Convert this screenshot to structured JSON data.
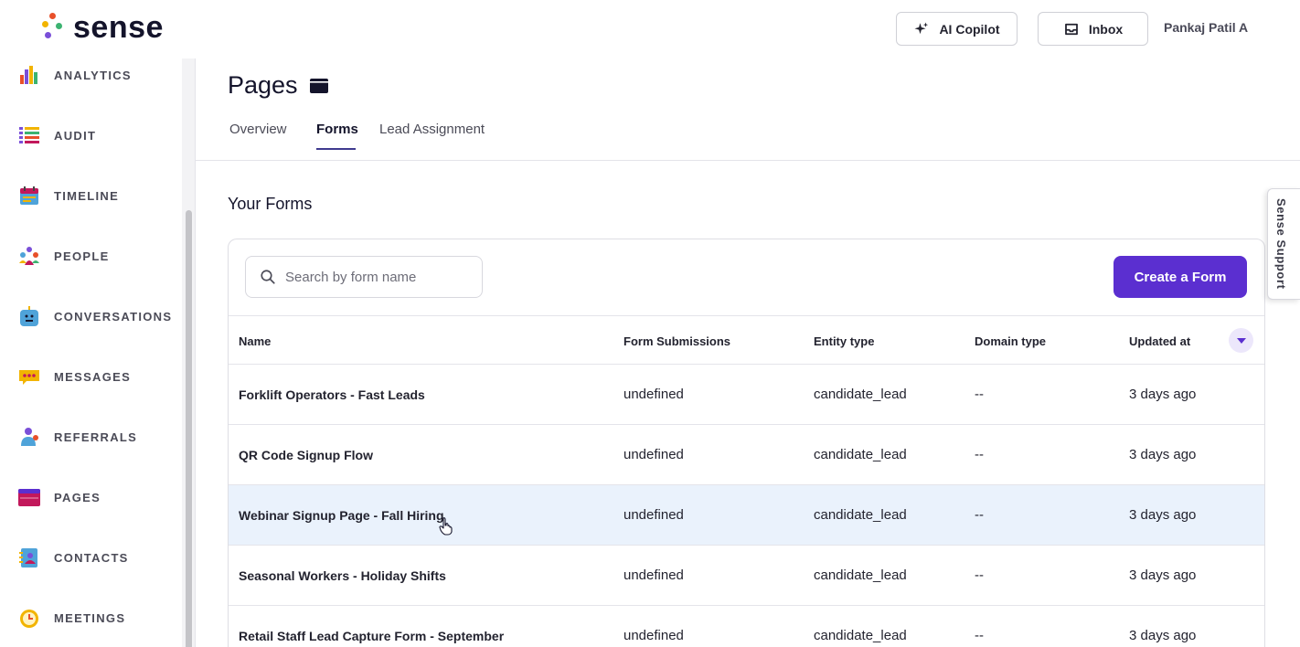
{
  "app": {
    "brand": "sense",
    "colors": {
      "accent": "#5b2fd0",
      "hover_row": "#eaf2fc",
      "logo_dots": [
        "#e8502a",
        "#f2b400",
        "#3cb371",
        "#7a4fd8"
      ]
    }
  },
  "header": {
    "copilot_label": "AI Copilot",
    "copilot_icon": "sparkle-icon",
    "inbox_label": "Inbox",
    "inbox_icon": "inbox-tray-icon",
    "user_name": "Pankaj Patil A"
  },
  "sidebar": {
    "items": [
      {
        "label": "ANALYTICS",
        "icon": "bar-chart-icon"
      },
      {
        "label": "AUDIT",
        "icon": "list-icon"
      },
      {
        "label": "TIMELINE",
        "icon": "calendar-icon"
      },
      {
        "label": "PEOPLE",
        "icon": "people-icon"
      },
      {
        "label": "CONVERSATIONS",
        "icon": "chat-bot-icon"
      },
      {
        "label": "MESSAGES",
        "icon": "message-bubble-icon"
      },
      {
        "label": "REFERRALS",
        "icon": "referral-person-icon"
      },
      {
        "label": "PAGES",
        "icon": "browser-window-icon"
      },
      {
        "label": "CONTACTS",
        "icon": "contact-book-icon"
      },
      {
        "label": "MEETINGS",
        "icon": "alarm-clock-icon"
      }
    ]
  },
  "main": {
    "title": "Pages",
    "tabs": [
      {
        "label": "Overview",
        "active": false
      },
      {
        "label": "Forms",
        "active": true
      },
      {
        "label": "Lead Assignment",
        "active": false
      }
    ],
    "section_title": "Your Forms",
    "search": {
      "placeholder": "Search by form name",
      "value": ""
    },
    "create_label": "Create a Form",
    "table": {
      "columns": [
        "Name",
        "Form Submissions",
        "Entity type",
        "Domain type",
        "Updated at"
      ],
      "rows": [
        {
          "name": "Forklift Operators - Fast Leads",
          "submissions": "undefined",
          "entity": "candidate_lead",
          "domain": "--",
          "updated": "3 days ago"
        },
        {
          "name": "QR Code Signup Flow",
          "submissions": "undefined",
          "entity": "candidate_lead",
          "domain": "--",
          "updated": "3 days ago"
        },
        {
          "name": "Webinar Signup Page - Fall Hiring",
          "submissions": "undefined",
          "entity": "candidate_lead",
          "domain": "--",
          "updated": "3 days ago"
        },
        {
          "name": "Seasonal Workers - Holiday Shifts",
          "submissions": "undefined",
          "entity": "candidate_lead",
          "domain": "--",
          "updated": "3 days ago"
        },
        {
          "name": "Retail Staff Lead Capture Form - September",
          "submissions": "undefined",
          "entity": "candidate_lead",
          "domain": "--",
          "updated": "3 days ago"
        }
      ]
    }
  },
  "support": {
    "label": "Sense Support"
  }
}
